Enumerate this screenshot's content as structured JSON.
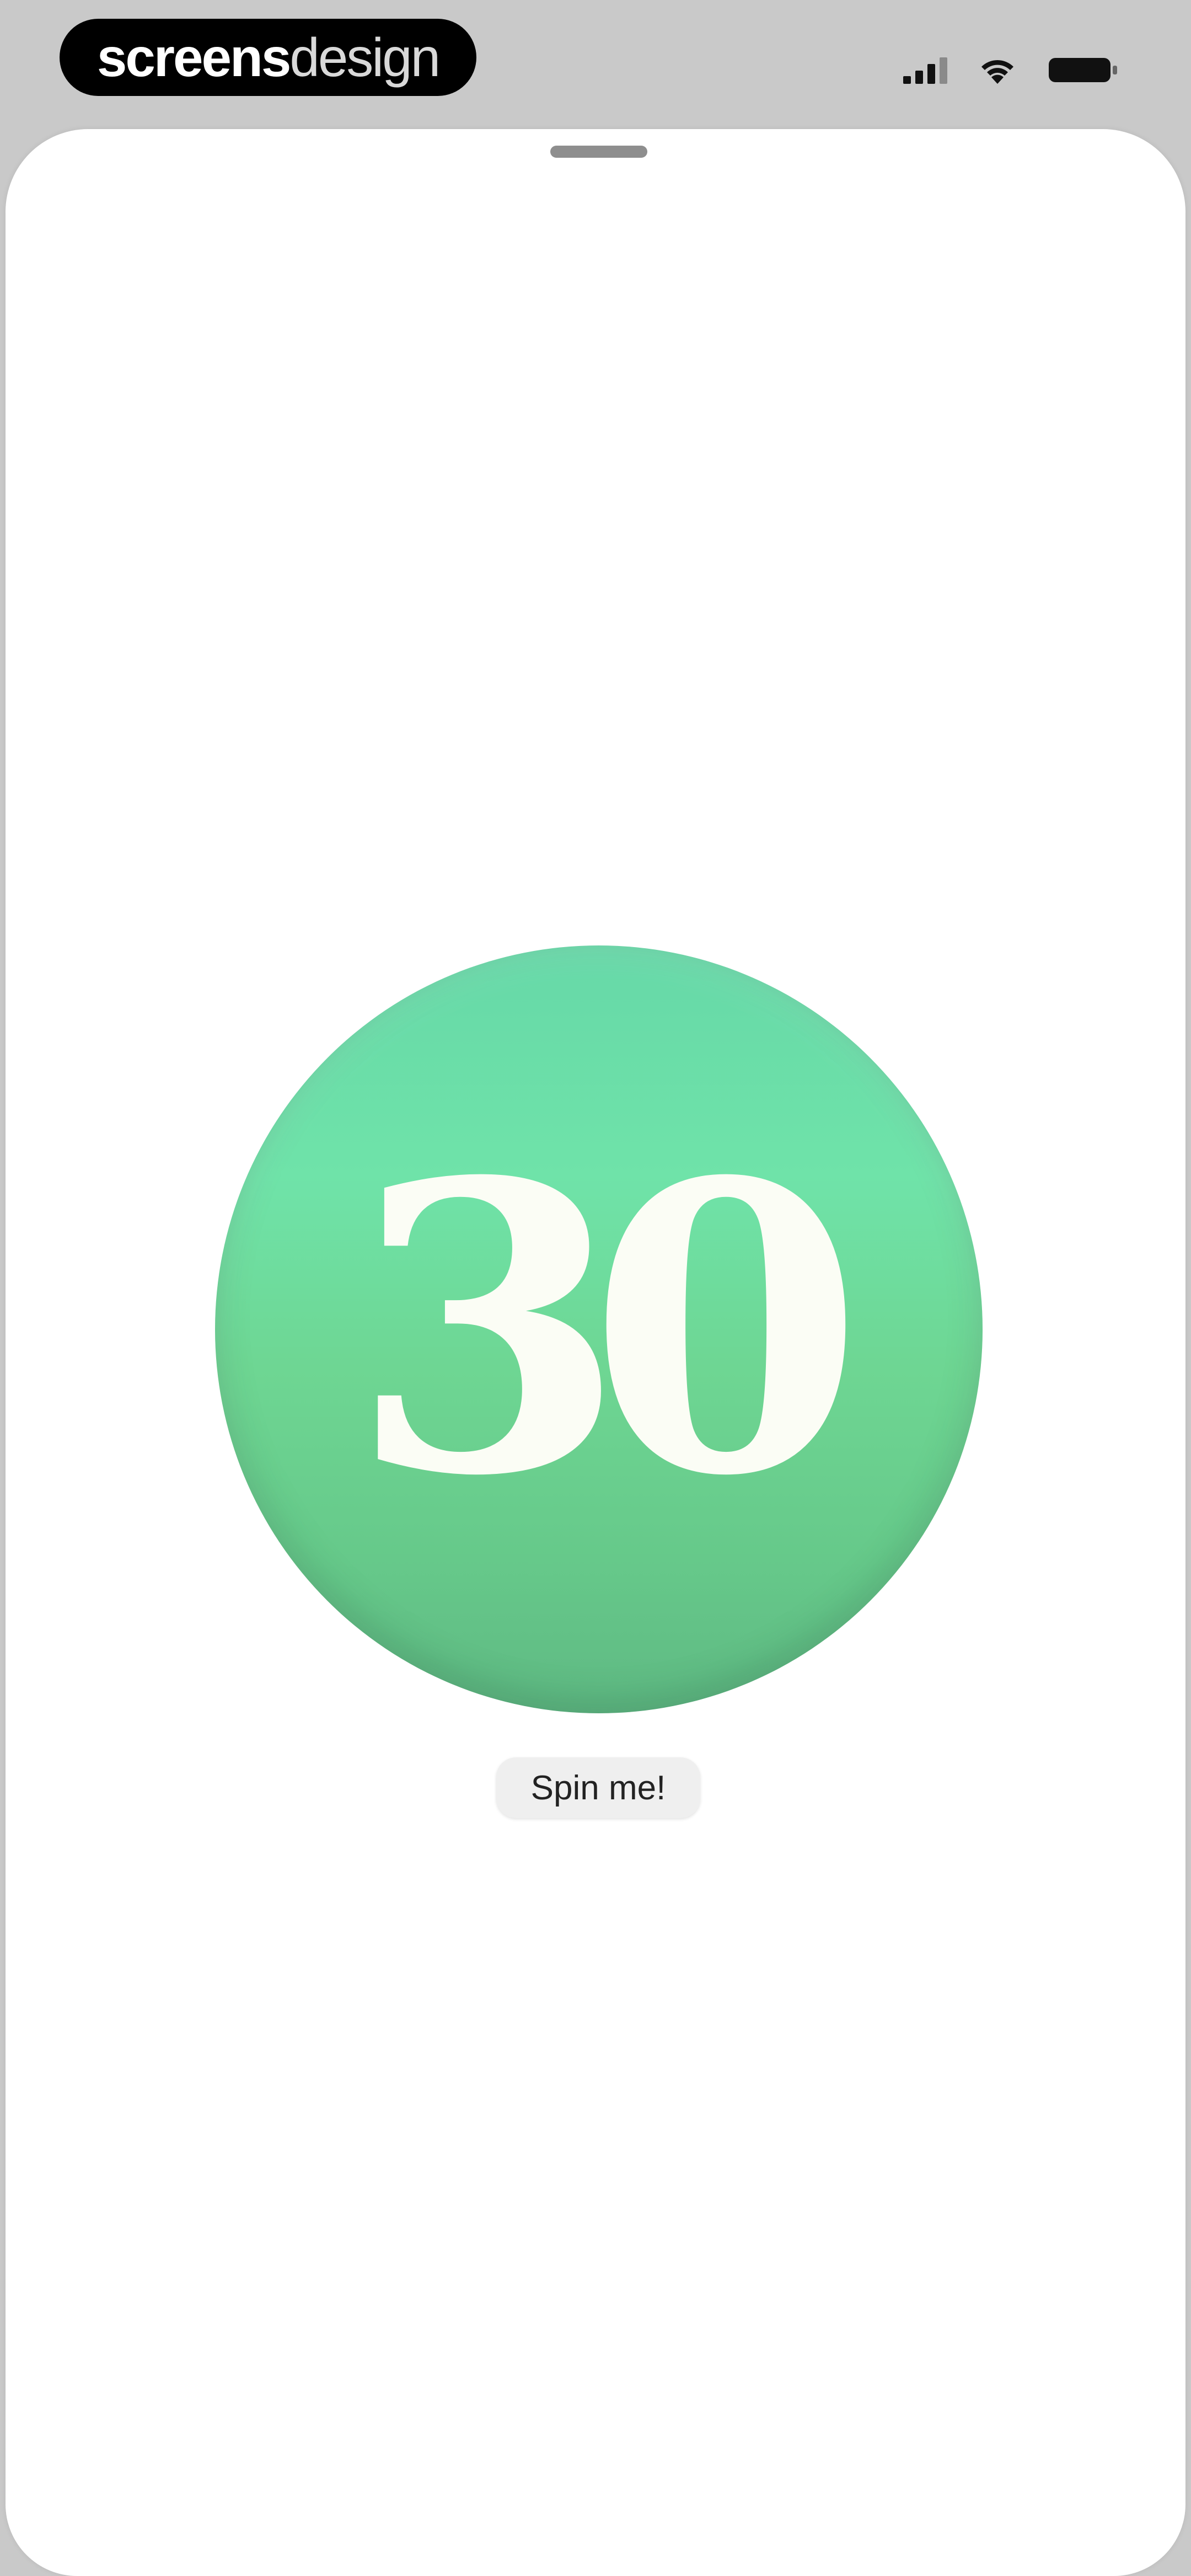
{
  "status_bar": {
    "brand_strong": "screens",
    "brand_light": "design",
    "icons": [
      "signal-icon",
      "wifi-icon",
      "battery-icon"
    ]
  },
  "main": {
    "disc_label": "30",
    "spin_button_label": "Spin me!"
  },
  "colors": {
    "disc_top": "#66d8a8",
    "disc_bottom": "#5fb983",
    "disc_text": "#fbfdf5",
    "button_bg": "#efefef"
  }
}
